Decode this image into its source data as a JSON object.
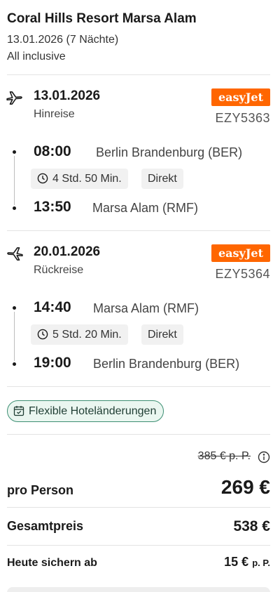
{
  "hotel": {
    "title": "Coral Hills Resort Marsa Alam",
    "dates": "13.01.2026 (7 Nächte)",
    "board": "All inclusive"
  },
  "outbound": {
    "icon": "plane-departure-icon",
    "date": "13.01.2026",
    "direction": "Hinreise",
    "airline": "easyJet",
    "flight_no": "EZY5363",
    "departure_time": "08:00",
    "departure_airport": "Berlin Brandenburg (BER)",
    "duration": "4 Std. 50 Min.",
    "stops": "Direkt",
    "arrival_time": "13:50",
    "arrival_airport": "Marsa Alam (RMF)"
  },
  "return": {
    "icon": "plane-arrival-icon",
    "date": "20.01.2026",
    "direction": "Rückreise",
    "airline": "easyJet",
    "flight_no": "EZY5364",
    "departure_time": "14:40",
    "departure_airport": "Marsa Alam (RMF)",
    "duration": "5 Std. 20 Min.",
    "stops": "Direkt",
    "arrival_time": "19:00",
    "arrival_airport": "Berlin Brandenburg (BER)"
  },
  "badge": {
    "label": "Flexible Hoteländerungen",
    "icon": "calendar-check-icon"
  },
  "pricing": {
    "old_price": "385 € p. P.",
    "per_person_label": "pro Person",
    "per_person_price": "269 €",
    "total_label": "Gesamtpreis",
    "total_price": "538 €",
    "deposit_label": "Heute sichern ab",
    "deposit_price": "15 €",
    "deposit_unit": "p. P."
  },
  "colors": {
    "airline_brand": "#ff6600",
    "badge_border": "#3d8f73",
    "badge_bg": "#eaf6f0"
  }
}
